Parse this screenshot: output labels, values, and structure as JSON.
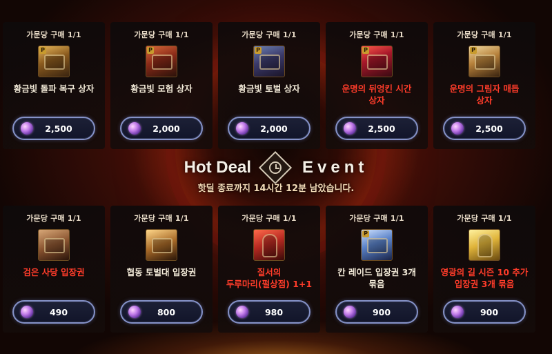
{
  "colors": {
    "limit_text": "#e9dcc8",
    "name_default": "#f2ead8",
    "name_highlight": "#ff3c2a",
    "price_button_border": "#8592c8"
  },
  "banner": {
    "title_left": "Hot Deal",
    "title_icon": "clock-icon",
    "title_right": "Event",
    "countdown": "핫딜 종료까지 14시간 12분 남았습니다."
  },
  "currency_icon": "purple-gem-icon",
  "top_items": [
    {
      "limit": "가문당 구매 1/1",
      "name": "황금빛 돌파 복구 상자",
      "highlight": false,
      "icon": "gold-chest-icon",
      "price": "2,500"
    },
    {
      "limit": "가문당 구매 1/1",
      "name": "황금빛 모험 상자",
      "highlight": false,
      "icon": "red-chest-icon",
      "price": "2,000"
    },
    {
      "limit": "가문당 구매 1/1",
      "name": "황금빛 토벌 상자",
      "highlight": false,
      "icon": "blue-chest-icon",
      "price": "2,000"
    },
    {
      "limit": "가문당 구매 1/1",
      "name": "운명의 뒤엉킨 시간\n상자",
      "highlight": true,
      "icon": "ruby-chest-icon",
      "price": "2,500"
    },
    {
      "limit": "가문당 구매 1/1",
      "name": "운명의 그림자 매듭\n상자",
      "highlight": true,
      "icon": "ornate-chest-icon",
      "price": "2,500"
    }
  ],
  "bottom_items": [
    {
      "limit": "가문당 구매 1/1",
      "name": "검은 사당 입장권",
      "highlight": true,
      "icon": "brown-ticket-icon",
      "price": "490"
    },
    {
      "limit": "가문당 구매 1/1",
      "name": "협동 토벌대 입장권",
      "highlight": false,
      "icon": "gold-ticket-icon",
      "price": "800"
    },
    {
      "limit": "가문당 구매 1/1",
      "name": "질서의\n두루마리(펄상점) 1+1",
      "highlight": true,
      "icon": "red-scroll-icon",
      "price": "980"
    },
    {
      "limit": "가문당 구매 1/1",
      "name": "칸 레이드 입장권 3개\n묶음",
      "highlight": false,
      "icon": "blue-ticket-icon",
      "price": "900"
    },
    {
      "limit": "가문당 구매 1/1",
      "name": "영광의 길 시즌 10 추가\n입장권 3개 묶음",
      "highlight": true,
      "icon": "gold-scroll-icon",
      "price": "900"
    }
  ]
}
